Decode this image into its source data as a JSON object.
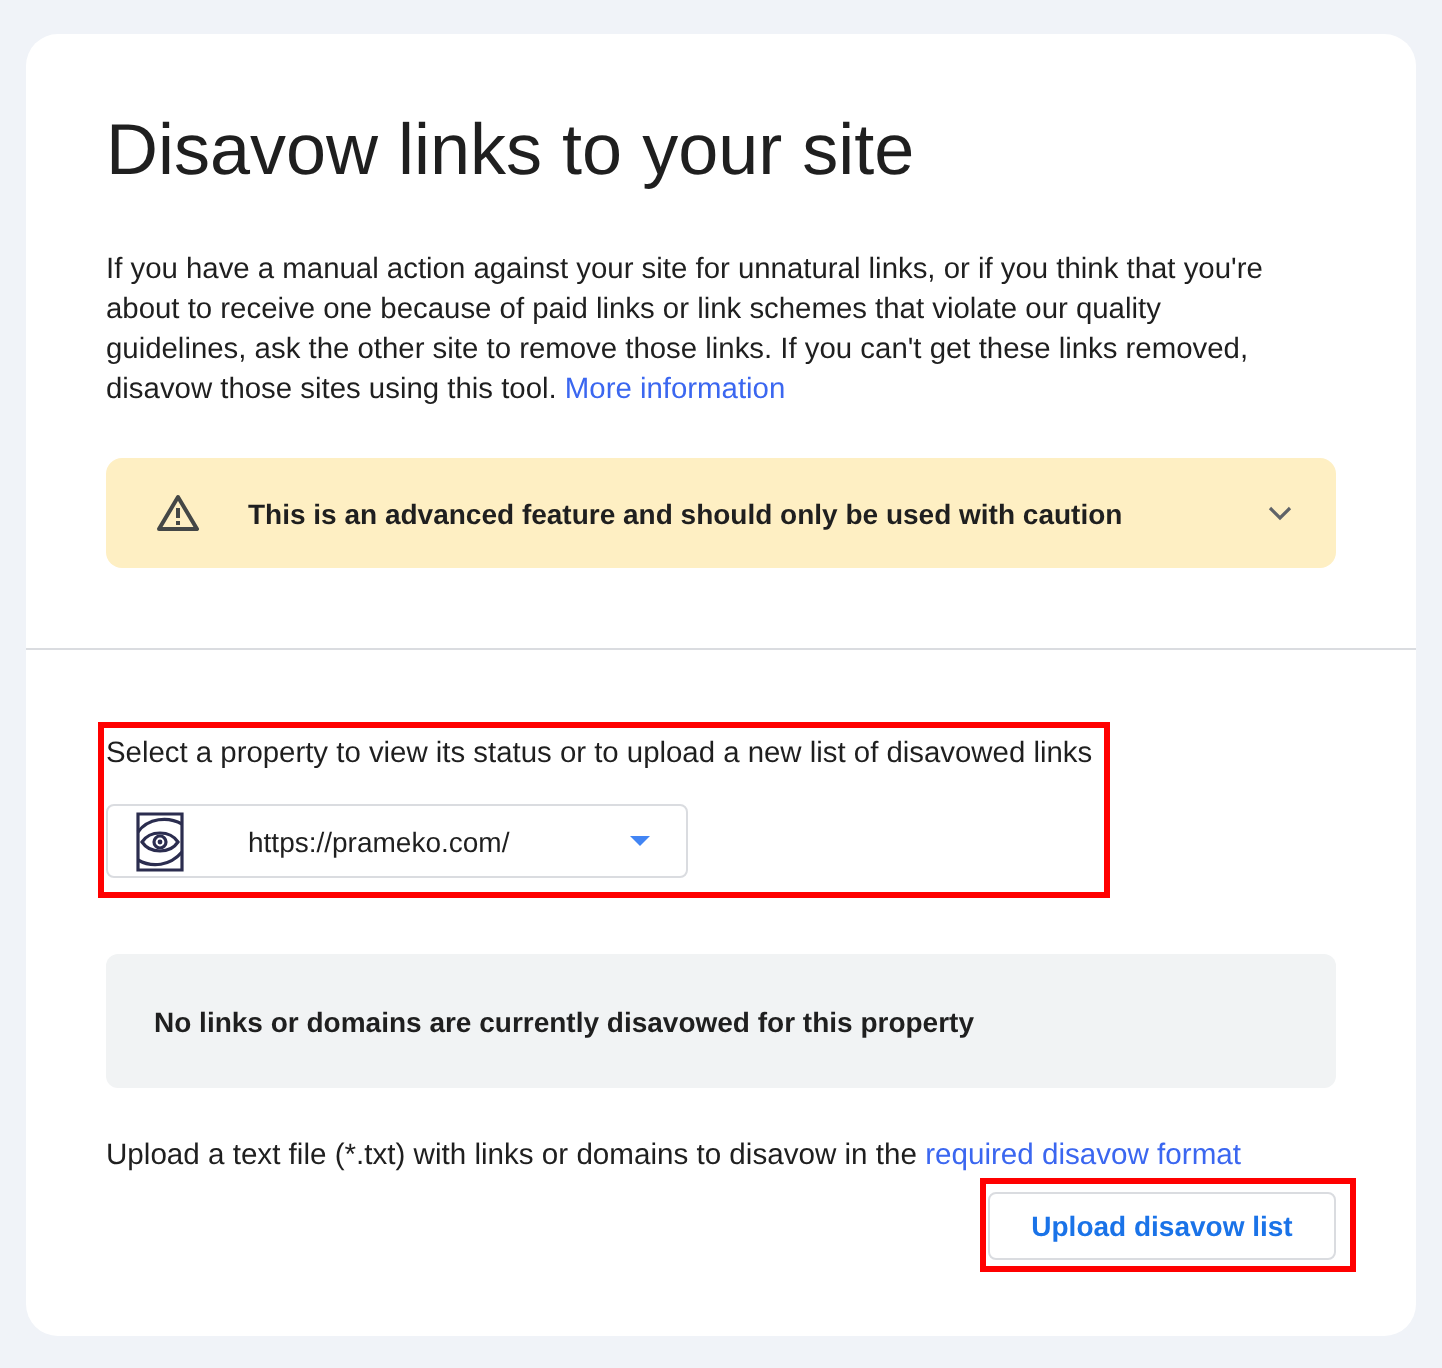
{
  "page": {
    "title": "Disavow links to your site"
  },
  "intro": {
    "text": "If you have a manual action against your site for unnatural links, or if you think that you're about to receive one because of paid links or link schemes that violate our quality guidelines, ask the other site to remove those links. If you can't get these links removed, disavow those sites using this tool.",
    "link": "More information"
  },
  "warning_banner": {
    "text": "This is an advanced feature and should only be used with caution",
    "expanded": false
  },
  "property_section": {
    "highlighted": true,
    "label": "Select a property to view its status or to upload a new list of disavowed links",
    "property_select": {
      "value": "https://prameko.com/"
    }
  },
  "status_message": "No links or domains are currently disavowed for this property",
  "upload": {
    "text": "Upload a text file (*.txt) with links or domains to disavow in the",
    "link": "required disavow format",
    "button": {
      "label": "Upload disavow list",
      "highlighted": true
    }
  }
}
